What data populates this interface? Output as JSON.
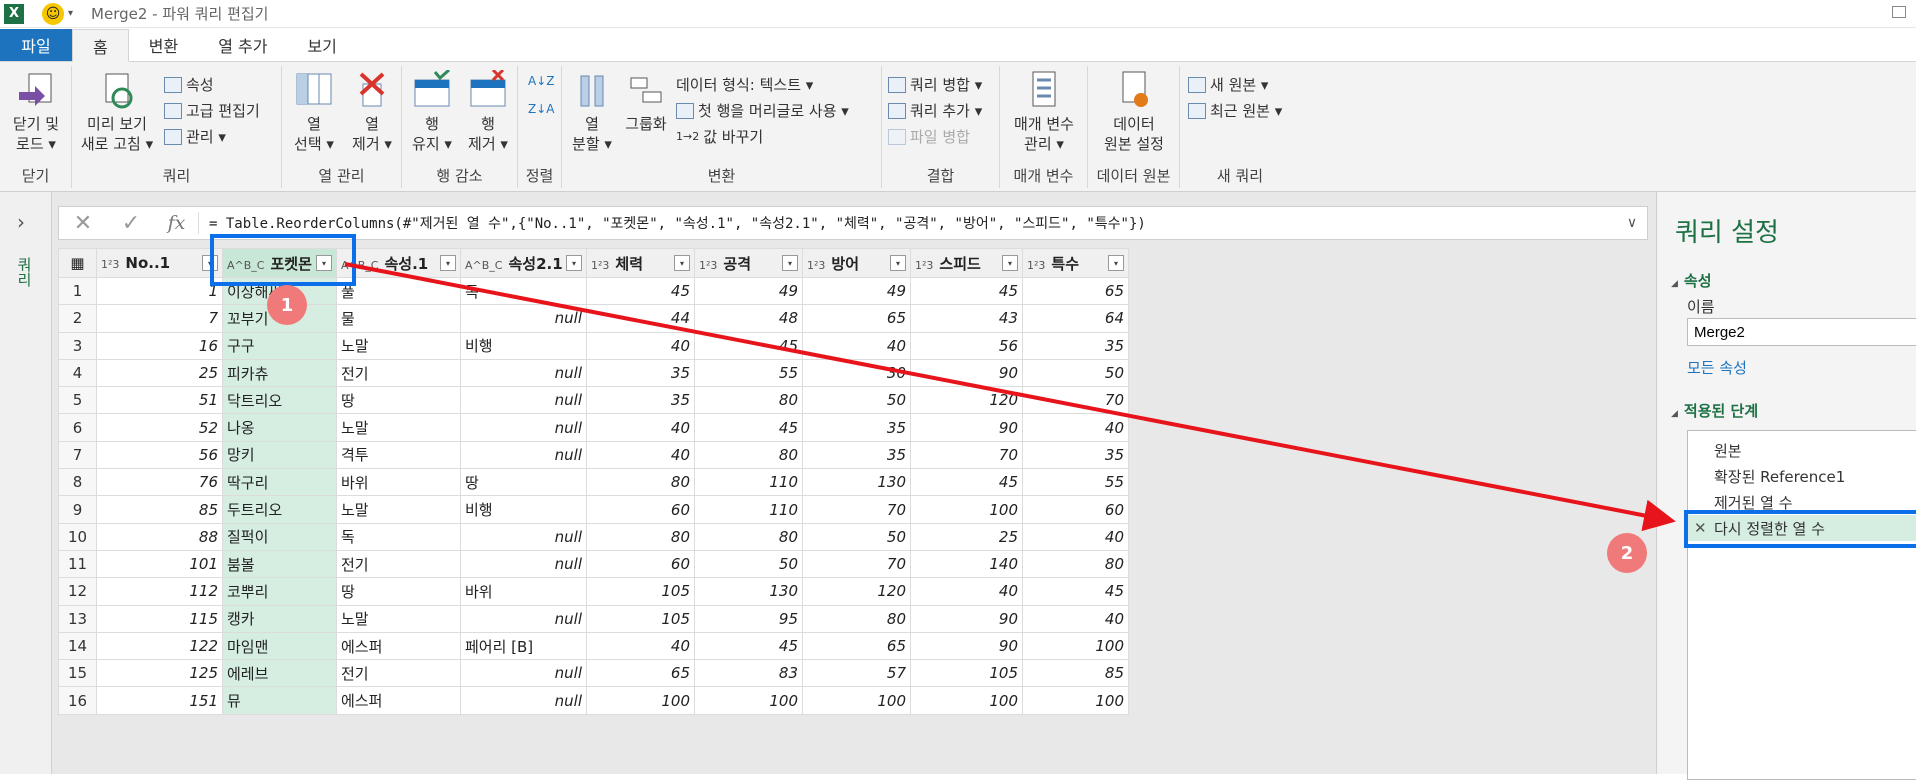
{
  "titlebar": {
    "app_icon": "X",
    "title": "Merge2 - 파워 쿼리 편집기"
  },
  "tabs": [
    "파일",
    "홈",
    "변환",
    "열 추가",
    "보기"
  ],
  "ribbon": {
    "close_load": [
      "닫기 및",
      "로드 ▾"
    ],
    "refresh": [
      "미리 보기",
      "새로 고침 ▾"
    ],
    "properties": "속성",
    "advanced_editor": "고급 편집기",
    "manage": "관리 ▾",
    "choose_cols": [
      "열",
      "선택 ▾"
    ],
    "remove_cols": [
      "열",
      "제거 ▾"
    ],
    "keep_rows": [
      "행",
      "유지 ▾"
    ],
    "remove_rows": [
      "행",
      "제거 ▾"
    ],
    "split_col": [
      "열",
      "분할 ▾"
    ],
    "group_by": "그룹화",
    "data_type": "데이터 형식: 텍스트 ▾",
    "first_row_header": "첫 행을 머리글로 사용 ▾",
    "replace_values": "값 바꾸기",
    "merge_queries": "쿼리 병합 ▾",
    "append_queries": "쿼리 추가 ▾",
    "combine_files": "파일 병합",
    "manage_params": [
      "매개 변수",
      "관리 ▾"
    ],
    "datasource_settings": [
      "데이터",
      "원본 설정"
    ],
    "new_source": "새 원본 ▾",
    "recent_sources": "최근 원본 ▾",
    "groups": [
      "닫기",
      "쿼리",
      "열 관리",
      "행 감소",
      "정렬",
      "변환",
      "결합",
      "매개 변수",
      "데이터 원본",
      "새 쿼리"
    ]
  },
  "leftpane": {
    "label": "쿼리"
  },
  "formula": "= Table.ReorderColumns(#\"제거된 열 수\",{\"No..1\", \"포켓몬\", \"속성.1\", \"속성2.1\", \"체력\", \"공격\", \"방어\", \"스피드\", \"특수\"})",
  "columns": [
    {
      "type": "1²3",
      "name": "No..1"
    },
    {
      "type": "A^B_C",
      "name": "포켓몬"
    },
    {
      "type": "A^B_C",
      "name": "속성.1"
    },
    {
      "type": "A^B_C",
      "name": "속성2.1"
    },
    {
      "type": "1²3",
      "name": "체력"
    },
    {
      "type": "1²3",
      "name": "공격"
    },
    {
      "type": "1²3",
      "name": "방어"
    },
    {
      "type": "1²3",
      "name": "스피드"
    },
    {
      "type": "1²3",
      "name": "특수"
    }
  ],
  "rows": [
    [
      "1",
      "1",
      "이상해씨",
      "풀",
      "독",
      "45",
      "49",
      "49",
      "45",
      "65"
    ],
    [
      "2",
      "7",
      "꼬부기",
      "물",
      "null",
      "44",
      "48",
      "65",
      "43",
      "64"
    ],
    [
      "3",
      "16",
      "구구",
      "노말",
      "비행",
      "40",
      "45",
      "40",
      "56",
      "35"
    ],
    [
      "4",
      "25",
      "피카츄",
      "전기",
      "null",
      "35",
      "55",
      "30",
      "90",
      "50"
    ],
    [
      "5",
      "51",
      "닥트리오",
      "땅",
      "null",
      "35",
      "80",
      "50",
      "120",
      "70"
    ],
    [
      "6",
      "52",
      "나옹",
      "노말",
      "null",
      "40",
      "45",
      "35",
      "90",
      "40"
    ],
    [
      "7",
      "56",
      "망키",
      "격투",
      "null",
      "40",
      "80",
      "35",
      "70",
      "35"
    ],
    [
      "8",
      "76",
      "딱구리",
      "바위",
      "땅",
      "80",
      "110",
      "130",
      "45",
      "55"
    ],
    [
      "9",
      "85",
      "두트리오",
      "노말",
      "비행",
      "60",
      "110",
      "70",
      "100",
      "60"
    ],
    [
      "10",
      "88",
      "질퍽이",
      "독",
      "null",
      "80",
      "80",
      "50",
      "25",
      "40"
    ],
    [
      "11",
      "101",
      "붐볼",
      "전기",
      "null",
      "60",
      "50",
      "70",
      "140",
      "80"
    ],
    [
      "12",
      "112",
      "코뿌리",
      "땅",
      "바위",
      "105",
      "130",
      "120",
      "40",
      "45"
    ],
    [
      "13",
      "115",
      "캥카",
      "노말",
      "null",
      "105",
      "95",
      "80",
      "90",
      "40"
    ],
    [
      "14",
      "122",
      "마임맨",
      "에스퍼",
      "페어리 [B]",
      "40",
      "45",
      "65",
      "90",
      "100"
    ],
    [
      "15",
      "125",
      "에레브",
      "전기",
      "null",
      "65",
      "83",
      "57",
      "105",
      "85"
    ],
    [
      "16",
      "151",
      "뮤",
      "에스퍼",
      "null",
      "100",
      "100",
      "100",
      "100",
      "100"
    ]
  ],
  "settings": {
    "title": "쿼리 설정",
    "props_section": "속성",
    "name_label": "이름",
    "name_value": "Merge2",
    "all_props": "모든 속성",
    "steps_section": "적용된 단계",
    "steps": [
      "원본",
      "확장된 Reference1",
      "제거된 열 수",
      "다시 정렬한 열 수"
    ]
  },
  "annotations": [
    "1",
    "2"
  ],
  "colors": {
    "accent": "#1e7145",
    "file_tab": "#1e73be",
    "highlight": "#d6eee2",
    "callout_box": "#0a6fe8",
    "arrow": "#e8141b",
    "badge": "#f07a7a"
  }
}
